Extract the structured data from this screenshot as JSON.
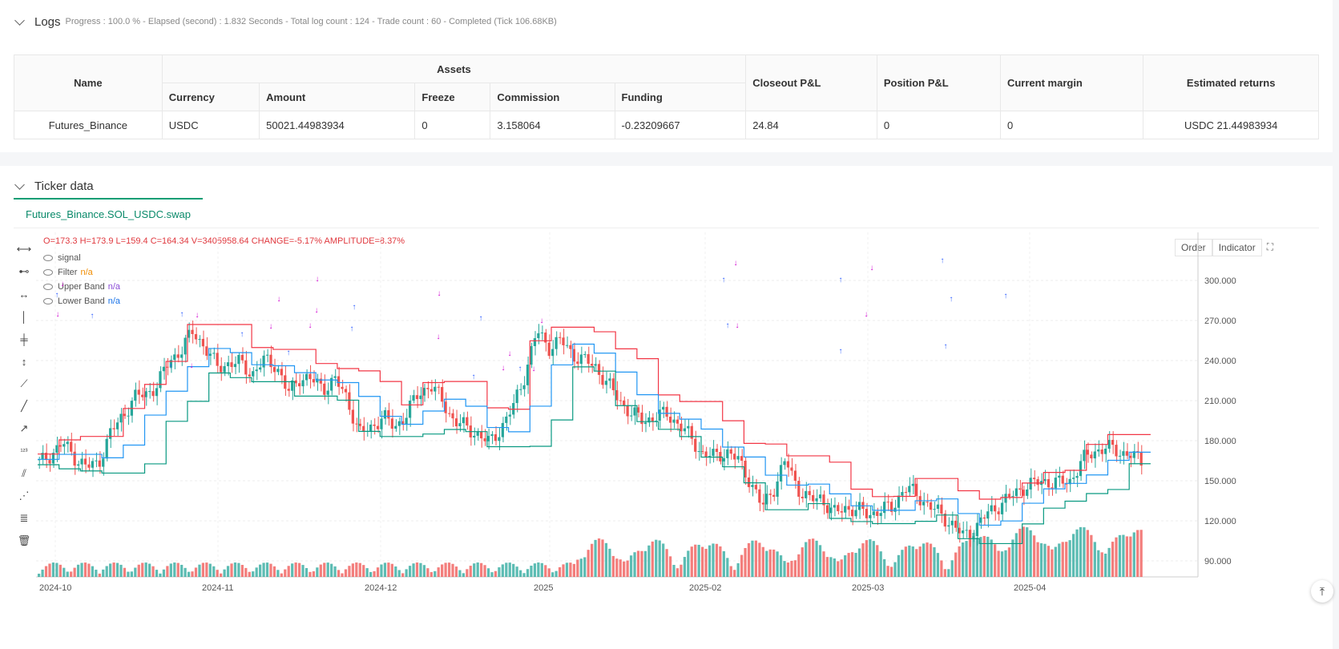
{
  "logs": {
    "title": "Logs",
    "summary": "Progress : 100.0 % - Elapsed (second) : 1.832 Seconds - Total log count : 124 - Trade count : 60 - Completed (Tick 106.68KB)"
  },
  "assets_table": {
    "headers": {
      "name": "Name",
      "assets": "Assets",
      "currency": "Currency",
      "amount": "Amount",
      "freeze": "Freeze",
      "commission": "Commission",
      "funding": "Funding",
      "closeout": "Closeout P&L",
      "position": "Position P&L",
      "margin": "Current margin",
      "returns": "Estimated returns"
    },
    "row": {
      "name": "Futures_Binance",
      "currency": "USDC",
      "amount": "50021.44983934",
      "freeze": "0",
      "commission": "3.158064",
      "funding": "-0.23209667",
      "closeout": "24.84",
      "position": "0",
      "margin": "0",
      "returns": "USDC 21.44983934"
    }
  },
  "ticker": {
    "title": "Ticker data",
    "tab": "Futures_Binance.SOL_USDC.swap",
    "ohlc": {
      "o": "O=173.3",
      "h": "H=173.9",
      "l": "L=159.4",
      "c": "C=164.34",
      "v": "V=3405958.64",
      "change": "CHANGE=-5.17%",
      "amplitude": "AMPLITUDE=8.37%"
    },
    "legend": {
      "signal": "signal",
      "filter": "Filter",
      "filter_val": "n/a",
      "upper": "Upper Band",
      "upper_val": "n/a",
      "lower": "Lower Band",
      "lower_val": "n/a"
    },
    "buttons": {
      "order": "Order",
      "indicator": "Indicator"
    },
    "icons": [
      "horizontal-line-icon",
      "horizontal-ray-icon",
      "horizontal-segment-icon",
      "vertical-line-icon",
      "vertical-segment-icon",
      "vertical-ray-icon",
      "trend-line-icon",
      "trend-segment-icon",
      "ray-icon",
      "price-label-icon",
      "parallel-channel-icon",
      "pitchfork-icon",
      "fibonacci-icon",
      "trash-icon"
    ],
    "colors": {
      "up": "#26a69a",
      "down": "#ef5350",
      "upper_band": "#f23645",
      "filter": "#2196f3",
      "lower_band": "#089981",
      "long": "#3060ff",
      "short": "#d000d0"
    }
  },
  "chart_data": {
    "type": "candlestick",
    "y_ticks": [
      "300.000",
      "270.000",
      "240.000",
      "210.000",
      "180.000",
      "150.000",
      "120.000",
      "90.000"
    ],
    "x_ticks": [
      "2024-10",
      "2024-11",
      "2024-12",
      "2025",
      "2025-02",
      "2025-03",
      "2025-04"
    ],
    "ylim": [
      78,
      330
    ],
    "close_path": [
      [
        0,
        163
      ],
      [
        4,
        170
      ],
      [
        8,
        178
      ],
      [
        12,
        168
      ],
      [
        16,
        160
      ],
      [
        20,
        163
      ],
      [
        24,
        185
      ],
      [
        28,
        198
      ],
      [
        32,
        212
      ],
      [
        36,
        215
      ],
      [
        40,
        222
      ],
      [
        44,
        240
      ],
      [
        48,
        248
      ],
      [
        52,
        262
      ],
      [
        56,
        250
      ],
      [
        60,
        235
      ],
      [
        64,
        238
      ],
      [
        68,
        238
      ],
      [
        72,
        230
      ],
      [
        76,
        240
      ],
      [
        80,
        237
      ],
      [
        84,
        215
      ],
      [
        88,
        228
      ],
      [
        92,
        225
      ],
      [
        96,
        220
      ],
      [
        100,
        225
      ],
      [
        104,
        212
      ],
      [
        108,
        185
      ],
      [
        112,
        190
      ],
      [
        116,
        198
      ],
      [
        120,
        190
      ],
      [
        124,
        200
      ],
      [
        128,
        215
      ],
      [
        132,
        222
      ],
      [
        136,
        210
      ],
      [
        140,
        195
      ],
      [
        144,
        190
      ],
      [
        148,
        185
      ],
      [
        152,
        178
      ],
      [
        156,
        190
      ],
      [
        160,
        205
      ],
      [
        164,
        230
      ],
      [
        168,
        262
      ],
      [
        172,
        250
      ],
      [
        176,
        255
      ],
      [
        180,
        245
      ],
      [
        184,
        240
      ],
      [
        188,
        235
      ],
      [
        192,
        222
      ],
      [
        196,
        210
      ],
      [
        200,
        200
      ],
      [
        204,
        195
      ],
      [
        208,
        198
      ],
      [
        212,
        200
      ],
      [
        216,
        192
      ],
      [
        220,
        182
      ],
      [
        224,
        170
      ],
      [
        228,
        168
      ],
      [
        232,
        172
      ],
      [
        236,
        165
      ],
      [
        240,
        150
      ],
      [
        244,
        130
      ],
      [
        248,
        145
      ],
      [
        252,
        165
      ],
      [
        256,
        145
      ],
      [
        260,
        135
      ],
      [
        264,
        138
      ],
      [
        268,
        125
      ],
      [
        272,
        130
      ],
      [
        276,
        128
      ],
      [
        280,
        125
      ],
      [
        284,
        128
      ],
      [
        288,
        130
      ],
      [
        292,
        145
      ],
      [
        296,
        140
      ],
      [
        300,
        132
      ],
      [
        304,
        125
      ],
      [
        308,
        118
      ],
      [
        312,
        108
      ],
      [
        316,
        115
      ],
      [
        320,
        125
      ],
      [
        324,
        132
      ],
      [
        328,
        138
      ],
      [
        332,
        145
      ],
      [
        336,
        148
      ],
      [
        340,
        150
      ],
      [
        344,
        148
      ],
      [
        348,
        150
      ],
      [
        352,
        165
      ],
      [
        356,
        172
      ],
      [
        360,
        175
      ],
      [
        364,
        172
      ],
      [
        368,
        170
      ],
      [
        372,
        164
      ]
    ],
    "long_markers": [
      [
        71,
        161
      ],
      [
        115,
        187
      ],
      [
        213,
        250
      ],
      [
        227,
        185
      ],
      [
        302,
        210
      ],
      [
        360,
        233
      ],
      [
        442,
        176
      ],
      [
        439,
        203
      ],
      [
        600,
        190
      ],
      [
        591,
        263
      ],
      [
        649,
        253
      ],
      [
        903,
        142
      ],
      [
        908,
        199
      ],
      [
        1049,
        142
      ],
      [
        1049,
        231
      ],
      [
        1176,
        118
      ],
      [
        1180,
        225
      ],
      [
        1255,
        162
      ],
      [
        1187,
        166
      ]
    ],
    "short_markers": [
      [
        72,
        195
      ],
      [
        78,
        157
      ],
      [
        239,
        259
      ],
      [
        246,
        196
      ],
      [
        338,
        210
      ],
      [
        348,
        176
      ],
      [
        387,
        209
      ],
      [
        395,
        190
      ],
      [
        396,
        151
      ],
      [
        548,
        169
      ],
      [
        547,
        223
      ],
      [
        628,
        262
      ],
      [
        636,
        244
      ],
      [
        666,
        263
      ],
      [
        676,
        203
      ],
      [
        918,
        131
      ],
      [
        920,
        209
      ],
      [
        1081,
        195
      ],
      [
        1088,
        137
      ]
    ]
  }
}
